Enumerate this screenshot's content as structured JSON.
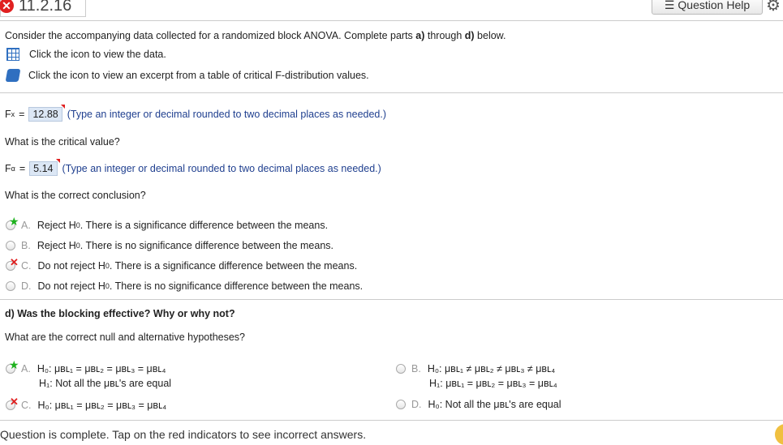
{
  "header": {
    "question_number": "11.2.16",
    "question_help_label": "Question Help",
    "help_icon": "list-icon",
    "settings_icon": "gear-icon"
  },
  "intro": {
    "prefix": "Consider the accompanying data collected for a randomized block ANOVA. Complete parts ",
    "a": "a)",
    "mid": " through ",
    "d": "d)",
    "suffix": " below.",
    "data_link": "Click the icon to view the data.",
    "table_link": "Click the icon to view an excerpt from a table of critical F-distribution values."
  },
  "fx": {
    "label": "F",
    "sub": "x",
    "eq": "=",
    "value": "12.88",
    "hint": "(Type an integer or decimal rounded to two decimal places as needed.)"
  },
  "critical_q": "What is the critical value?",
  "falpha": {
    "label": "F",
    "sub": "α",
    "eq": "=",
    "value": "5.14",
    "hint": "(Type an integer or decimal rounded to two decimal places as needed.)"
  },
  "conclusion_q": "What is the correct conclusion?",
  "conclusion_options": [
    {
      "letter": "A.",
      "pre": "Reject H",
      "sub": "0",
      "post": ". There is a significance difference between the means.",
      "mark": "★"
    },
    {
      "letter": "B.",
      "pre": "Reject H",
      "sub": "0",
      "post": ". There is no significance difference between the means.",
      "mark": ""
    },
    {
      "letter": "C.",
      "pre": "Do not reject H",
      "sub": "0",
      "post": ". There is a significance difference between the means.",
      "mark": "✕"
    },
    {
      "letter": "D.",
      "pre": "Do not reject H",
      "sub": "0",
      "post": ". There is no significance difference between the means.",
      "mark": ""
    }
  ],
  "part_d": {
    "question": "d) Was the blocking effective? Why or why not?",
    "sub_question": "What are the correct null and alternative hypotheses?"
  },
  "hyp": {
    "A": {
      "letter": "A.",
      "l1": "H₀: μʙʟ₁ = μʙʟ₂ = μʙʟ₃ = μʙʟ₄",
      "l2": "H₁: Not all the μʙʟ's are equal",
      "mark": "★"
    },
    "B": {
      "letter": "B.",
      "l1": "H₀: μʙʟ₁ ≠ μʙʟ₂ ≠ μʙʟ₃ ≠ μʙʟ₄",
      "l2": "H₁: μʙʟ₁ = μʙʟ₂ = μʙʟ₃ = μʙʟ₄",
      "mark": ""
    },
    "C": {
      "letter": "C.",
      "l1": "H₀: μʙʟ₁ = μʙʟ₂ = μʙʟ₃ = μʙʟ₄",
      "mark": "✕"
    },
    "D": {
      "letter": "D.",
      "l1": "H₀: Not all the μʙʟ's are equal",
      "mark": ""
    }
  },
  "status": "Question is complete. Tap on the red indicators to see incorrect answers.",
  "colors": {
    "accent": "#2f6fc0",
    "correct": "#1db21d",
    "incorrect": "#e02020",
    "answer_box": "#dce7f5"
  }
}
